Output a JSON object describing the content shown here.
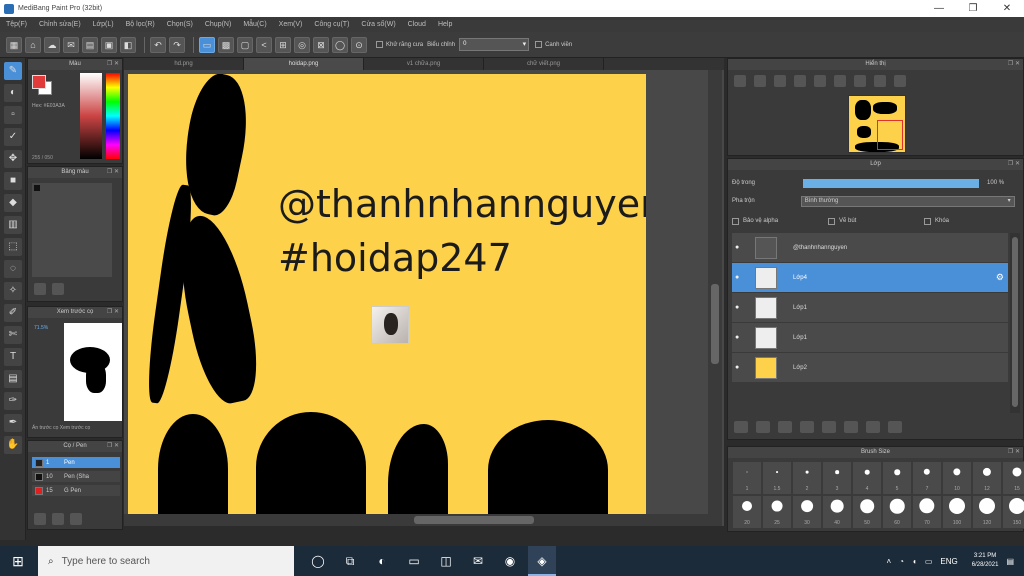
{
  "window": {
    "title": "MediBang Paint Pro (32bit)",
    "controls": [
      "—",
      "❐",
      "✕"
    ]
  },
  "menu": [
    "Tệp(F)",
    "Chỉnh sửa(E)",
    "Lớp(L)",
    "Bộ lọc(R)",
    "Chọn(S)",
    "Chụp(N)",
    "Mẫu(C)",
    "Xem(V)",
    "Công cụ(T)",
    "Cửa sổ(W)",
    "Cloud",
    "Help"
  ],
  "toolbar": {
    "auto_correct_label": "Khử răng cưa",
    "mode_label": "Biểu chỉnh",
    "mode_value": "0",
    "snap_label": "Canh viền"
  },
  "left_panels": {
    "color_title": "Màu",
    "color_info": "Hex: #E03A3A",
    "color_values": "255 / 050",
    "brush_title": "Bảng màu",
    "nav_title": "Xem trước cọ",
    "nav_zoom": "71.5%",
    "nav_foot": "Ẩn trước cọ   Xem trước cọ",
    "pen_title": "Cọ / Pen",
    "pens": [
      {
        "size": "1",
        "name": "Pen",
        "color": "#222222"
      },
      {
        "size": "10",
        "name": "Pen (Sha",
        "color": "#111111"
      },
      {
        "size": "15",
        "name": "G Pen",
        "color": "#e02020"
      }
    ]
  },
  "tabs": [
    "hd.png",
    "hoidap.png",
    "v1 chữa.png",
    "chữ viết.png"
  ],
  "canvas": {
    "line1": "@thanhnhannguyen",
    "line2": "#hoidap247"
  },
  "right_panels": {
    "fullview_title": "Hiển thị",
    "layer_title": "Lớp",
    "opacity_label": "Độ trong",
    "opacity_value": "100 %",
    "opacity": 1.0,
    "blend_label": "Pha trộn",
    "blend_value": "Bình thường",
    "check_alpha": "Bảo vệ alpha",
    "check_clip": "Vẽ bút",
    "check_lock": "Khóa",
    "layers": [
      {
        "name": "@thanhnhannguyen",
        "thumb": "text",
        "selected": false
      },
      {
        "name": "Lớp4",
        "thumb": "blank",
        "selected": true
      },
      {
        "name": "Lớp1",
        "thumb": "art",
        "selected": false
      },
      {
        "name": "Lớp1",
        "thumb": "art",
        "selected": false
      },
      {
        "name": "Lớp2",
        "thumb": "yellow",
        "selected": false
      }
    ],
    "brush_size_title": "Brush Size",
    "brush_sizes": [
      "1",
      "1.5",
      "2",
      "3",
      "4",
      "5",
      "7",
      "10",
      "12",
      "15",
      "20",
      "25",
      "30",
      "40",
      "50",
      "60",
      "70",
      "100",
      "120",
      "150"
    ]
  },
  "taskbar": {
    "search_placeholder": "Type here to search",
    "language": "ENG",
    "time": "3:21 PM",
    "date": "6/28/2021"
  }
}
